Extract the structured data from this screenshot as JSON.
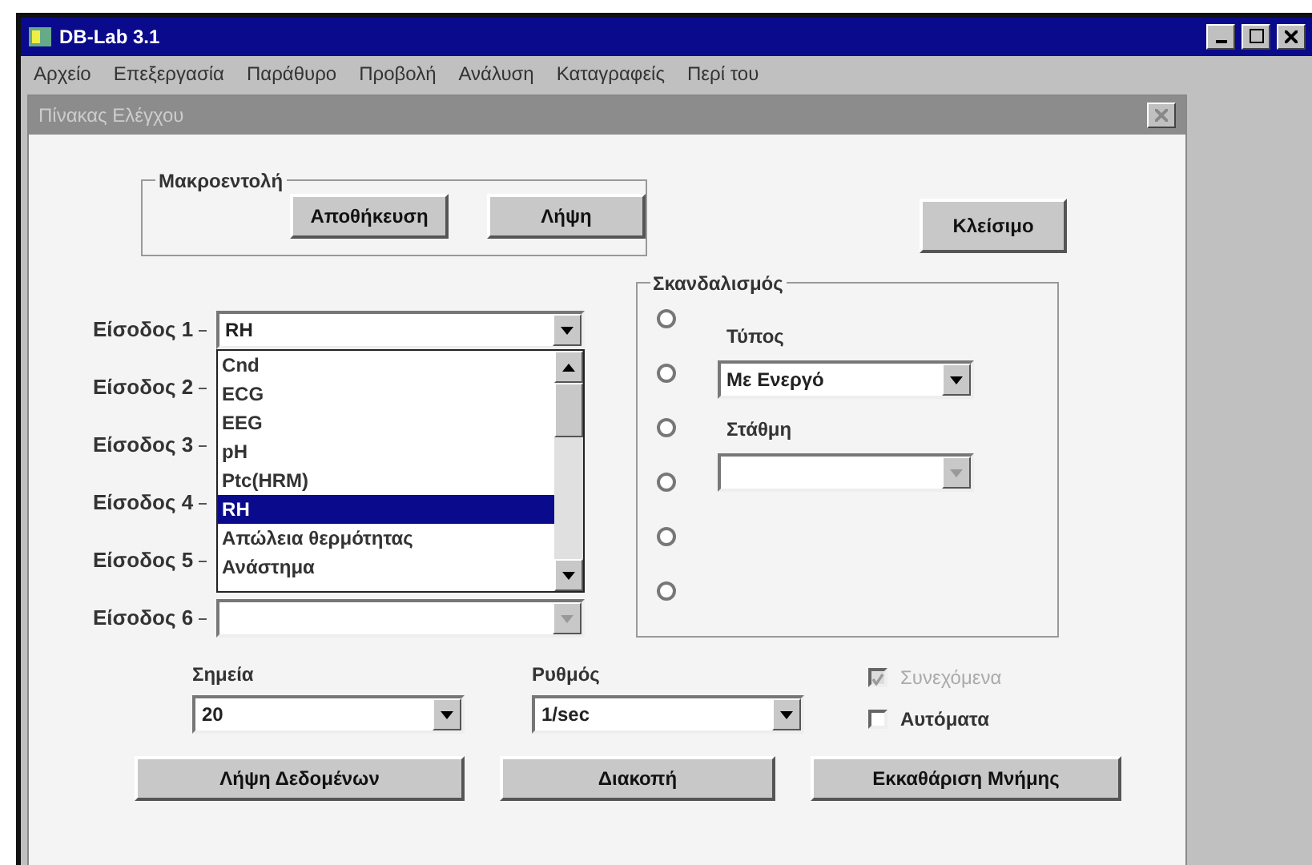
{
  "window": {
    "title": "DB-Lab 3.1"
  },
  "menu": [
    "Αρχείο",
    "Επεξεργασία",
    "Παράθυρο",
    "Προβολή",
    "Ανάλυση",
    "Καταγραφείς",
    "Περί του"
  ],
  "dialog": {
    "title": "Πίνακας Ελέγχου"
  },
  "macro": {
    "legend": "Μακροεντολή",
    "buttons": [
      "Αποθήκευση",
      "Λήψη"
    ]
  },
  "close_button": "Κλείσιμο",
  "inputs": [
    {
      "label": "Είσοδος 1",
      "kind": "dropdown",
      "value": "RH"
    },
    {
      "label": "Είσοδος 2",
      "kind": "hidden"
    },
    {
      "label": "Είσοδος 3",
      "kind": "hidden"
    },
    {
      "label": "Είσοδος 4",
      "kind": "hidden"
    },
    {
      "label": "Είσοδος 5",
      "kind": "hidden"
    },
    {
      "label": "Είσοδος 6",
      "kind": "dropdown"
    }
  ],
  "dropdown_list": [
    {
      "text": "Cnd",
      "selected": false
    },
    {
      "text": "ECG",
      "selected": false
    },
    {
      "text": "EEG",
      "selected": false
    },
    {
      "text": "pH",
      "selected": false
    },
    {
      "text": "Ptc(HRM)",
      "selected": false
    },
    {
      "text": "RH",
      "selected": true
    },
    {
      "text": "Απώλεια θερμότητας",
      "selected": false
    },
    {
      "text": "Ανάστημα",
      "selected": false
    }
  ],
  "trigger": {
    "legend": "Σκανδαλισμός",
    "radios": [
      {
        "selected": false
      },
      {
        "selected": false
      },
      {
        "selected": false
      },
      {
        "selected": false
      },
      {
        "selected": false
      },
      {
        "selected": false
      }
    ],
    "type_label": "Τύπος",
    "type_value": "Με Ενεργό",
    "level_label": "Στάθμη"
  },
  "points": {
    "label": "Σημεία",
    "value": "20"
  },
  "rate": {
    "label": "Ρυθμός",
    "value": "1/sec"
  },
  "checkboxes": [
    {
      "label": "Συνεχόμενα",
      "checked": true,
      "disabled": true
    },
    {
      "label": "Αυτόματα",
      "checked": false,
      "disabled": false
    }
  ],
  "buttons": [
    "Λήψη Δεδομένων",
    "Διακοπή",
    "Εκκαθάριση Μνήμης"
  ]
}
